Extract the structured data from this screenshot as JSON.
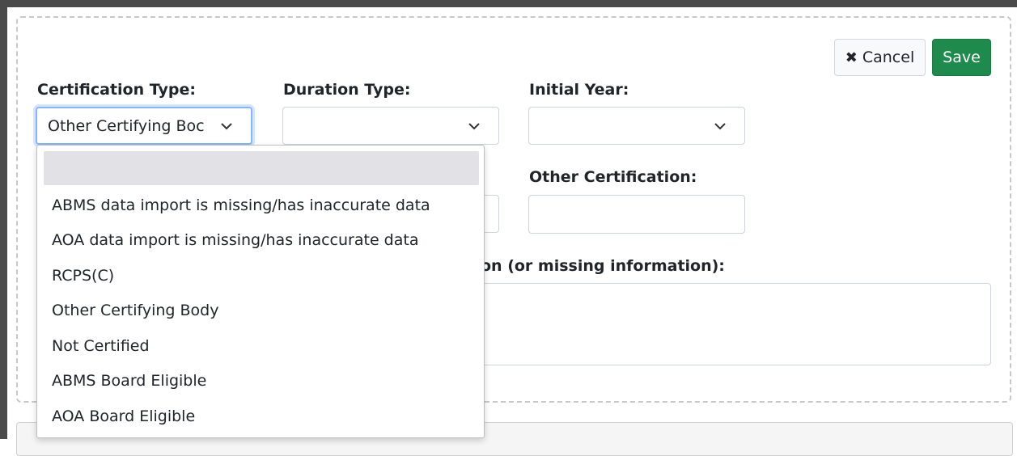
{
  "toolbar": {
    "cancel_label": "Cancel",
    "save_label": "Save"
  },
  "fields": {
    "certification_type": {
      "label": "Certification Type:",
      "value": "Other Certifying Boc"
    },
    "duration_type": {
      "label": "Duration Type:",
      "value": ""
    },
    "initial_year": {
      "label": "Initial Year:",
      "value": ""
    },
    "other_certification": {
      "label": "Other Certification:",
      "value": ""
    },
    "explanation": {
      "label_visible": "on (or missing information):",
      "value": ""
    }
  },
  "dropdown": {
    "options": [
      "",
      "ABMS data import is missing/has inaccurate data",
      "AOA data import is missing/has inaccurate data",
      "RCPS(C)",
      "Other Certifying Body",
      "Not Certified",
      "ABMS Board Eligible",
      "AOA Board Eligible"
    ]
  },
  "icons": {
    "cancel": "times-icon",
    "chevron": "chevron-down-icon"
  },
  "colors": {
    "save": "#1e8a4c",
    "focus": "#86b7fe",
    "highlight": "#e1e1e6"
  }
}
